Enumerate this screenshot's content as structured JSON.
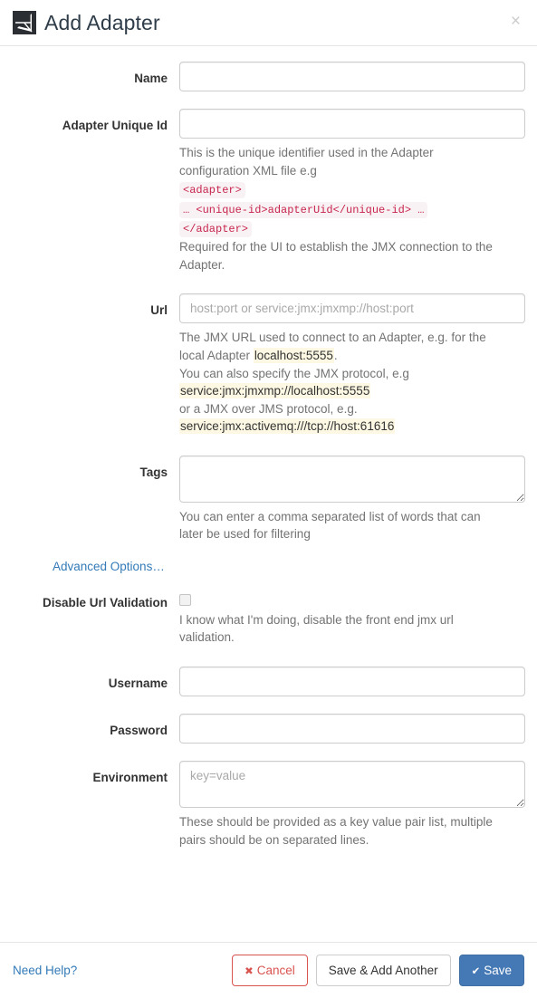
{
  "header": {
    "title": "Add Adapter",
    "logo_icon": "adapter-logo-icon",
    "close_icon": "close-icon",
    "close_label": "×"
  },
  "form": {
    "name": {
      "label": "Name",
      "value": "",
      "placeholder": ""
    },
    "adapter_unique_id": {
      "label": "Adapter Unique Id",
      "value": "",
      "placeholder": "",
      "help_line1": "This is the unique identifier used in the Adapter",
      "help_line2": "configuration XML file e.g",
      "code_line1": "<adapter>",
      "code_line2": "… <unique-id>adapterUid</unique-id> …",
      "code_line3": "</adapter>",
      "help_line3": "Required for the UI to establish the JMX connection to the",
      "help_line4": "Adapter."
    },
    "url": {
      "label": "Url",
      "value": "",
      "placeholder": "host:port or service:jmx:jmxmp://host:port",
      "help_line1": "The JMX URL used to connect to an Adapter, e.g. for the",
      "help_line2_pre": "local Adapter ",
      "help_line2_mark": "localhost:5555",
      "help_line2_post": ".",
      "help_line3": "You can also specify the JMX protocol, e.g",
      "mark_line1": "service:jmx:jmxmp://localhost:5555",
      "help_line4": "or a JMX over JMS protocol, e.g.",
      "mark_line2": "service:jmx:activemq:///tcp://host:61616"
    },
    "tags": {
      "label": "Tags",
      "value": "",
      "placeholder": "",
      "help_line1": "You can enter a comma separated list of words that can",
      "help_line2": "later be used for filtering"
    },
    "advanced_options": {
      "label": "Advanced Options…"
    },
    "disable_url_validation": {
      "label": "Disable Url Validation",
      "checked": false,
      "help_line1": "I know what I'm doing, disable the front end jmx url",
      "help_line2": "validation."
    },
    "username": {
      "label": "Username",
      "value": "",
      "placeholder": ""
    },
    "password": {
      "label": "Password",
      "value": "",
      "placeholder": ""
    },
    "environment": {
      "label": "Environment",
      "value": "",
      "placeholder": "key=value",
      "help_line1": "These should be provided as a key value pair list, multiple",
      "help_line2": "pairs should be on separated lines."
    }
  },
  "footer": {
    "need_help": "Need Help?",
    "cancel": "Cancel",
    "cancel_icon": "✖",
    "save_add_another": "Save & Add Another",
    "save": "Save",
    "save_icon": "✔"
  },
  "colors": {
    "link": "#337ab7",
    "primary": "#4479b5",
    "danger": "#d9534f",
    "code_text": "#c7254e",
    "code_bg": "#f9f2f4",
    "mark_bg": "#fcf8e3",
    "help_text": "#737373",
    "border": "#cccccc"
  }
}
